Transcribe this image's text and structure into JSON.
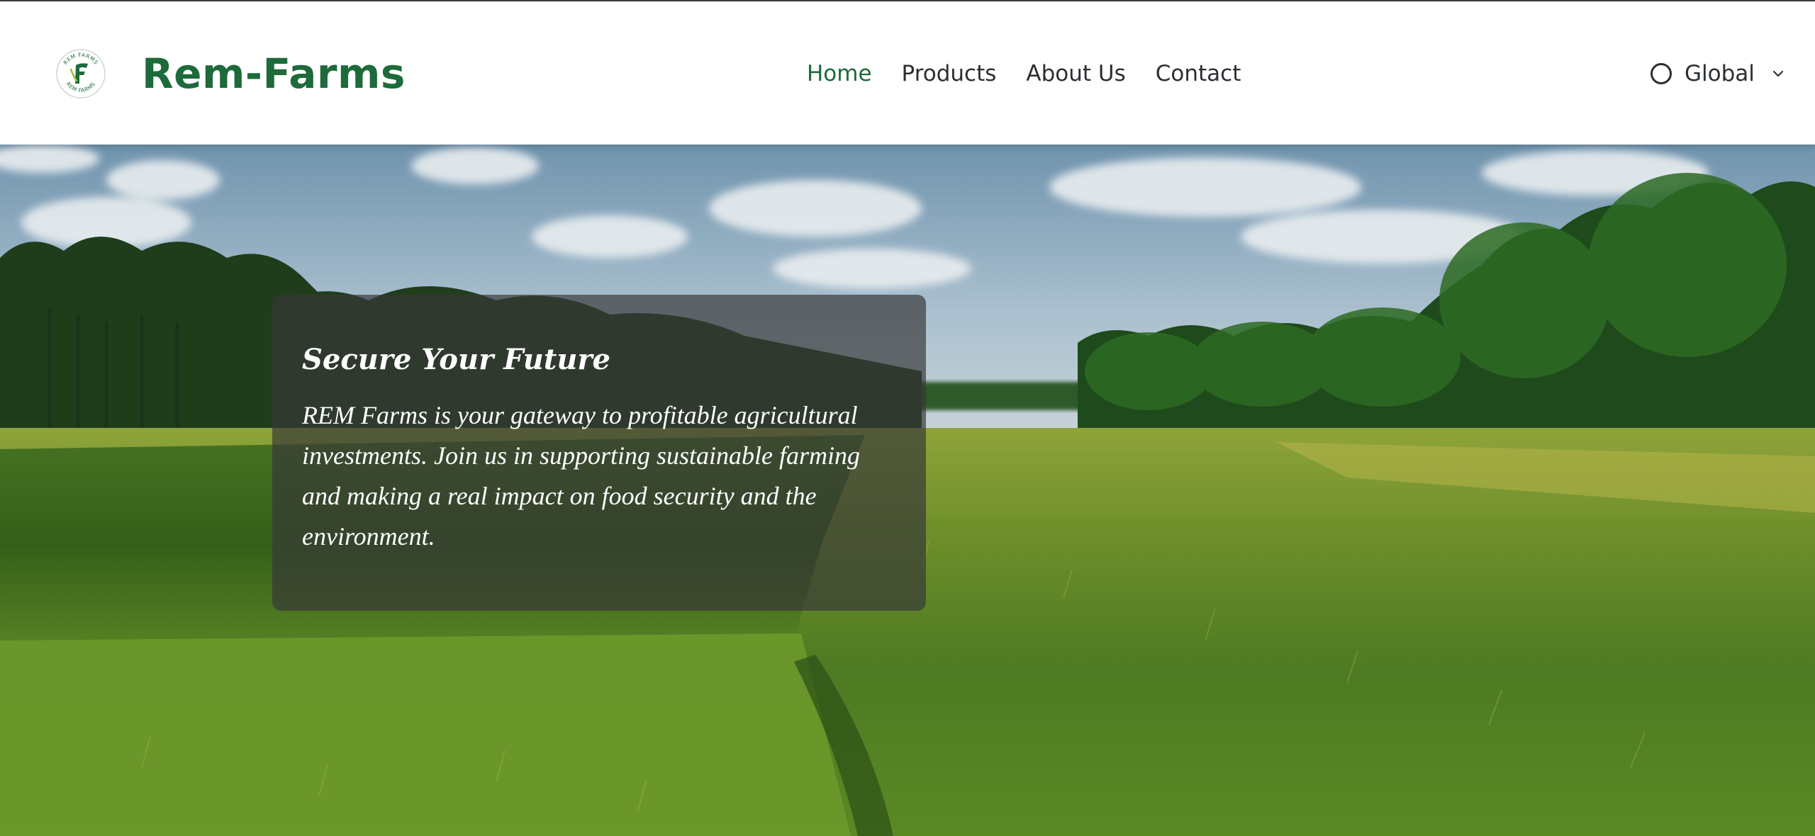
{
  "brand": {
    "name": "Rem-Farms",
    "logo_text_top": "REM FARMS",
    "logo_text_bottom": "REM FARMS",
    "logo_letter": "F",
    "color": "#1d6a3a"
  },
  "nav": {
    "items": [
      {
        "label": "Home",
        "active": true
      },
      {
        "label": "Products",
        "active": false
      },
      {
        "label": "About Us",
        "active": false
      },
      {
        "label": "Contact",
        "active": false
      }
    ]
  },
  "language": {
    "label": "Global",
    "icon": "globe-icon",
    "chevron": "chevron-down-icon"
  },
  "hero": {
    "title": "Secure Your Future",
    "text": "REM Farms is your gateway to profitable agricultural investments. Join us in supporting sustainable farming and making a real impact on food security and the environment."
  }
}
